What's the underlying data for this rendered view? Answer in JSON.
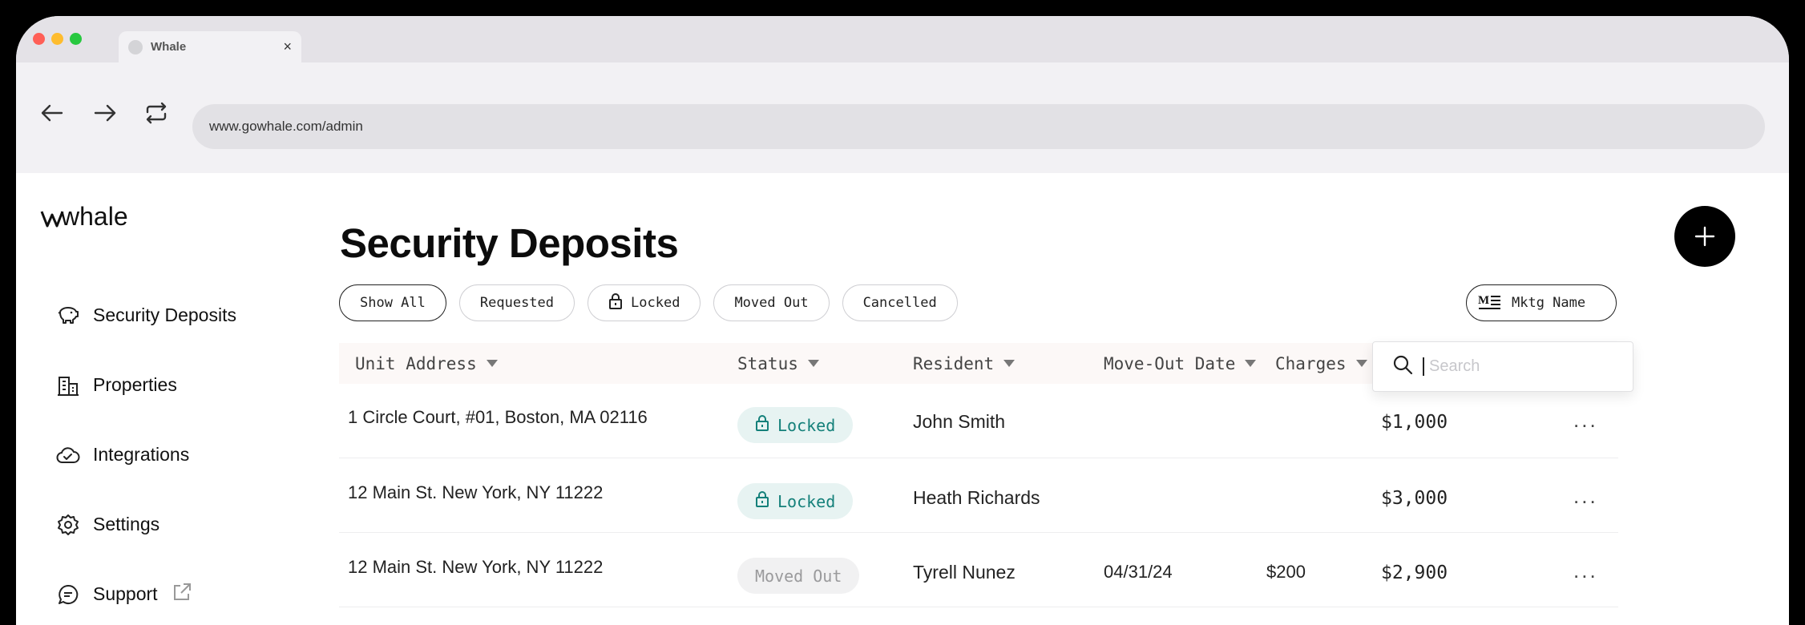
{
  "browser": {
    "tab_title": "Whale",
    "tab_close": "×",
    "url": "www.gowhale.com/admin"
  },
  "app": {
    "logo_text": "whale",
    "page_title": "Security Deposits",
    "fab_label": "+"
  },
  "sidebar": {
    "items": [
      {
        "label": "Security Deposits",
        "icon": "piggy-bank-icon"
      },
      {
        "label": "Properties",
        "icon": "building-icon"
      },
      {
        "label": "Integrations",
        "icon": "cloud-check-icon"
      },
      {
        "label": "Settings",
        "icon": "gear-icon"
      },
      {
        "label": "Support",
        "icon": "chat-icon"
      }
    ]
  },
  "filters": {
    "chips": [
      "Show All",
      "Requested",
      "Locked",
      "Moved Out",
      "Cancelled"
    ],
    "active": "Show All",
    "sort_label": "Mktg Name"
  },
  "search": {
    "placeholder": "Search"
  },
  "table": {
    "headers": [
      "Unit Address",
      "Status",
      "Resident",
      "Move-Out Date",
      "Charges"
    ],
    "rows": [
      {
        "address": "1 Circle Court, #01, Boston, MA 02116",
        "status": "Locked",
        "resident": "John Smith",
        "move_out": "",
        "charges": "",
        "amount": "$1,000",
        "more": "..."
      },
      {
        "address": "12 Main St. New York, NY 11222",
        "status": "Locked",
        "resident": "Heath Richards",
        "move_out": "",
        "charges": "",
        "amount": "$3,000",
        "more": "..."
      },
      {
        "address": "12 Main St. New York, NY 11222",
        "status": "Moved Out",
        "resident": "Tyrell Nunez",
        "move_out": "04/31/24",
        "charges": "$200",
        "amount": "$2,900",
        "more": "..."
      }
    ]
  },
  "colors": {
    "locked_bg": "#e7f3f2",
    "locked_text": "#14807a",
    "moved_bg": "#f1f1f2",
    "moved_text": "#9a9a9c"
  }
}
